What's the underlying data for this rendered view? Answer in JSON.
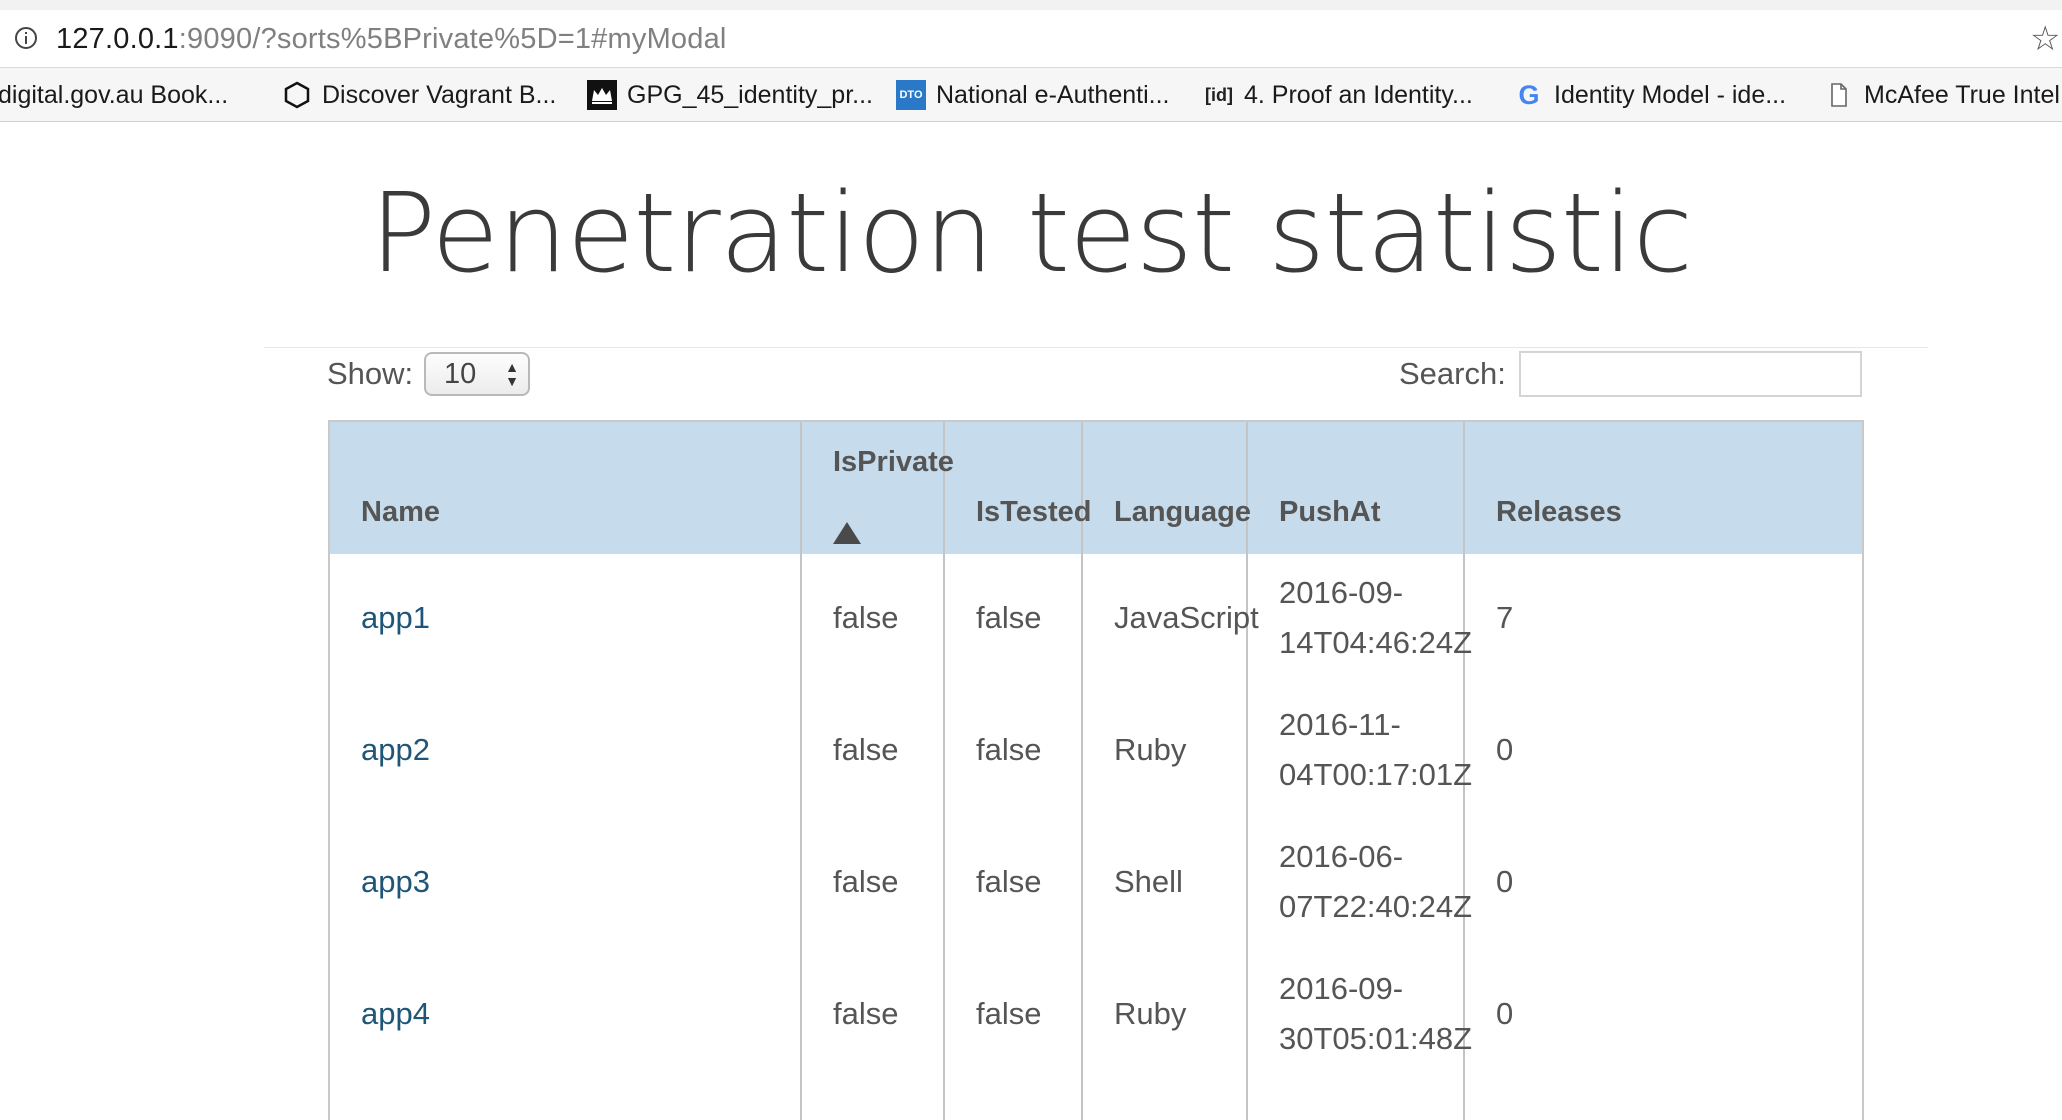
{
  "browser": {
    "url_host": "127.0.0.1",
    "url_rest": ":9090/?sorts%5BPrivate%5D=1#myModal",
    "bookmarks": [
      {
        "label": "digital.gov.au Book...",
        "icon": "none"
      },
      {
        "label": "Discover Vagrant B...",
        "icon": "vagrant-hexagon-icon"
      },
      {
        "label": "GPG_45_identity_pr...",
        "icon": "crown-icon"
      },
      {
        "label": "National e-Authenti...",
        "icon": "dto-icon",
        "icon_text": "DTO"
      },
      {
        "label": "4. Proof an Identity...",
        "icon": "id-icon",
        "icon_text": "[id]"
      },
      {
        "label": "Identity Model - ide...",
        "icon": "google-icon",
        "icon_text": "G"
      },
      {
        "label": "McAfee True Intel",
        "icon": "page-icon"
      }
    ]
  },
  "page": {
    "title": "Penetration test statistic",
    "show_label": "Show:",
    "show_value": "10",
    "search_label": "Search:",
    "search_value": ""
  },
  "table": {
    "columns": [
      "Name",
      "IsPrivate",
      "IsTested",
      "Language",
      "PushAt",
      "Releases"
    ],
    "sorted_column": "IsPrivate",
    "sort_direction": "ascending",
    "rows": [
      {
        "name": "app1",
        "private": "false",
        "tested": "false",
        "language": "JavaScript",
        "push_date": "2016-09-",
        "push_time": "14T04:46:24Z",
        "releases": "7"
      },
      {
        "name": "app2",
        "private": "false",
        "tested": "false",
        "language": "Ruby",
        "push_date": "2016-11-",
        "push_time": "04T00:17:01Z",
        "releases": "0"
      },
      {
        "name": "app3",
        "private": "false",
        "tested": "false",
        "language": "Shell",
        "push_date": "2016-06-",
        "push_time": "07T22:40:24Z",
        "releases": "0"
      },
      {
        "name": "app4",
        "private": "false",
        "tested": "false",
        "language": "Ruby",
        "push_date": "2016-09-",
        "push_time": "30T05:01:48Z",
        "releases": "0"
      }
    ]
  },
  "colors": {
    "header_bg": "#c6dcec",
    "link": "#1f5678",
    "text": "#555555"
  }
}
